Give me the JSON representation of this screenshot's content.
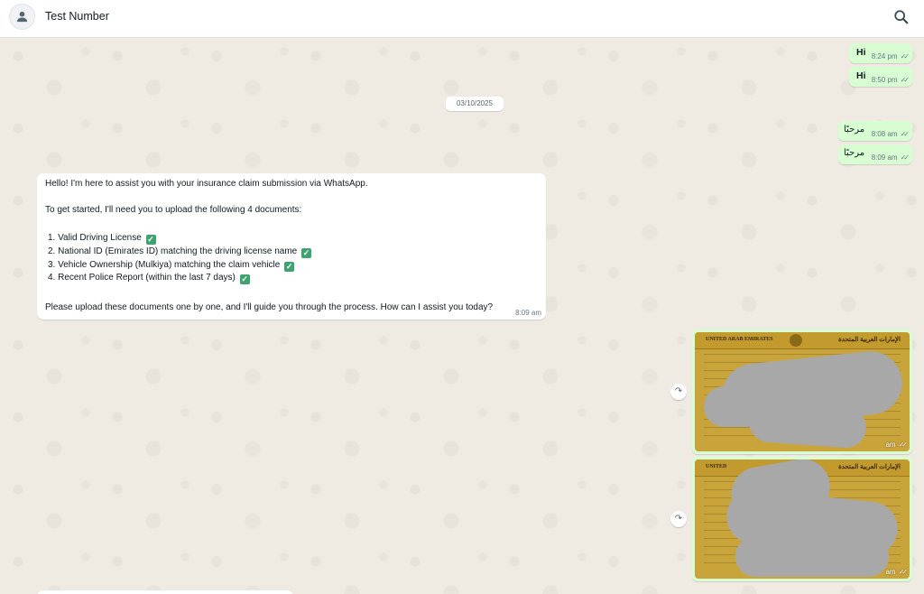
{
  "header": {
    "contact_name": "Test Number",
    "avatar_icon": "person-icon",
    "search_icon": "search-icon"
  },
  "messages_out_top": [
    {
      "text": "Hi",
      "time": "8:24 pm",
      "status": "read"
    },
    {
      "text": "Hi",
      "time": "8:50 pm",
      "status": "read"
    }
  ],
  "date_divider": "03/10/2025",
  "messages_out_mid": [
    {
      "text": "مرحبًا",
      "time": "8:08 am",
      "status": "read"
    },
    {
      "text": "مرحبًا",
      "time": "8:09 am",
      "status": "read"
    }
  ],
  "bot_message": {
    "intro": "Hello! I'm here to assist you with your insurance claim submission via WhatsApp.",
    "instruction": "To get started, I'll need you to upload the following 4 documents:",
    "items": [
      {
        "num": "1.",
        "text": "Valid Driving License"
      },
      {
        "num": "2.",
        "text": "National ID (Emirates ID) matching the driving license name"
      },
      {
        "num": "3.",
        "text": "Vehicle Ownership (Mulkiya) matching the claim vehicle"
      },
      {
        "num": "4.",
        "text": "Recent Police Report (within the last 7 days)"
      }
    ],
    "closing": "Please upload these documents one by one, and I'll guide you through the process. How can I assist you today?",
    "time": "8:09 am"
  },
  "image_messages": [
    {
      "banner_en": "UNITED ARAB EMIRATES",
      "banner_ar": "الإمارات العربية المتحدة",
      "time_suffix": "am",
      "status": "read"
    },
    {
      "banner_en": "UNITED",
      "banner_ar": "الإمارات العربية المتحدة",
      "time_suffix": "am",
      "status": "read"
    }
  ],
  "colors": {
    "outgoing_bubble": "#d9fdd3",
    "incoming_bubble": "#ffffff",
    "chat_background": "#efeae2",
    "check_emoji": "#3ea36f"
  }
}
